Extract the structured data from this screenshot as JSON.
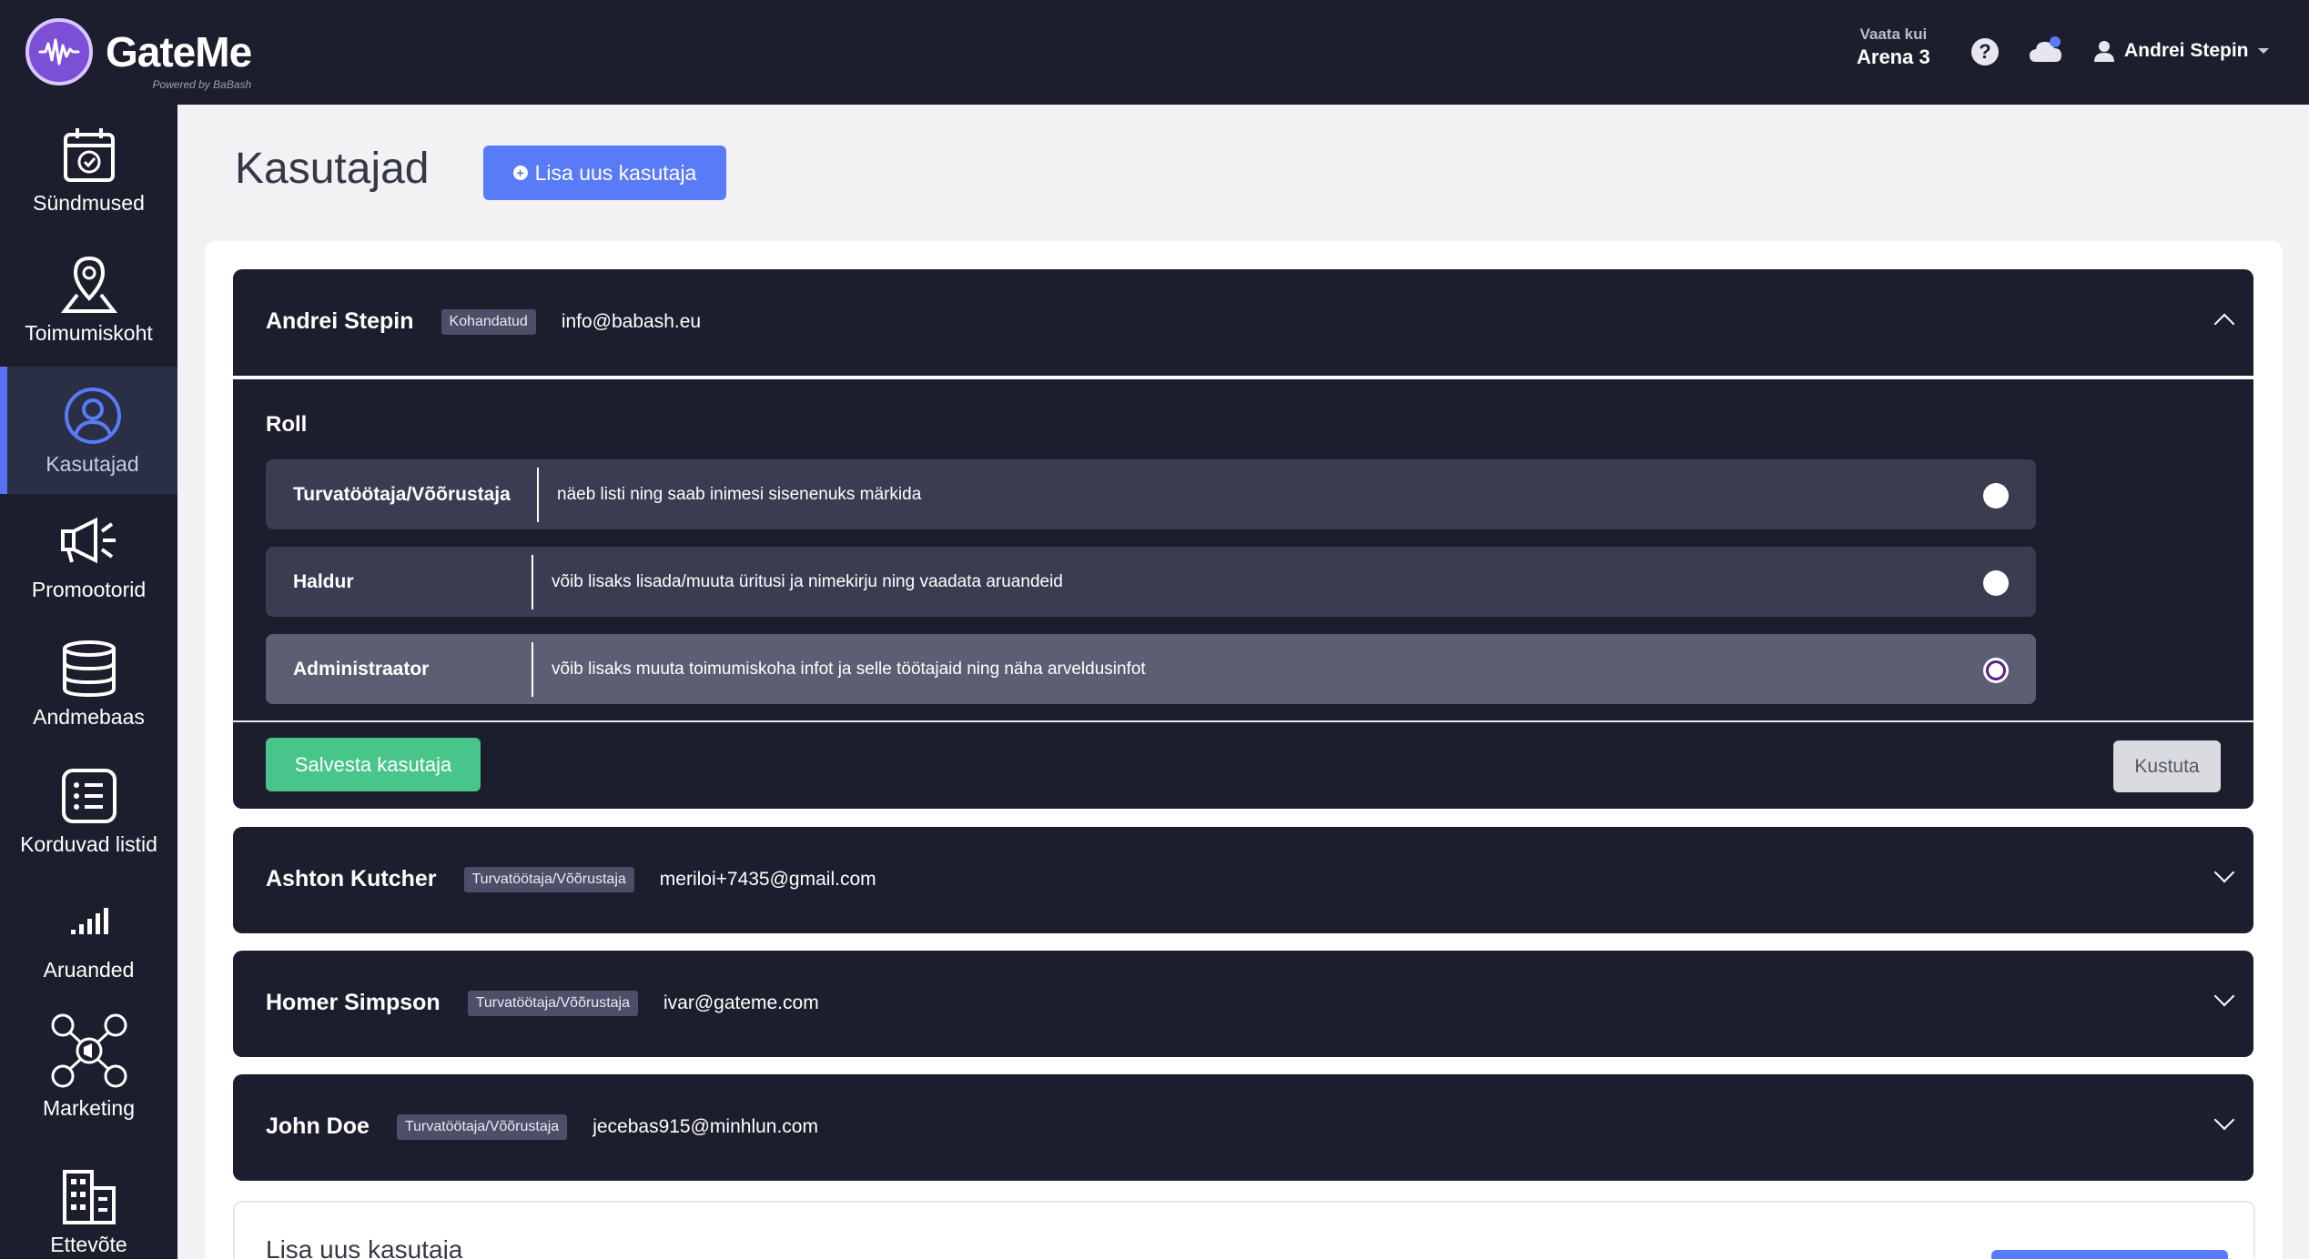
{
  "brand": {
    "name": "GateMe",
    "subtitle": "Powered by BaBash",
    "accent": "#7b4fd6"
  },
  "header": {
    "view_as_label": "Vaata kui",
    "view_as_value": "Arena 3",
    "help_icon": "question-circle-icon",
    "notifications_icon": "cloud-icon",
    "user_name": "Andrei Stepin"
  },
  "sidebar": {
    "items": [
      {
        "label": "Sündmused",
        "icon": "calendar-icon"
      },
      {
        "label": "Toimumiskoht",
        "icon": "location-pin-icon"
      },
      {
        "label": "Kasutajad",
        "icon": "user-icon",
        "active": true
      },
      {
        "label": "Promootorid",
        "icon": "megaphone-icon"
      },
      {
        "label": "Andmebaas",
        "icon": "database-icon"
      },
      {
        "label": "Korduvad listid",
        "icon": "list-icon"
      },
      {
        "label": "Aruanded",
        "icon": "signal-bars-icon"
      },
      {
        "label": "Marketing",
        "icon": "social-network-icon"
      },
      {
        "label": "Ettevõte",
        "icon": "building-icon"
      }
    ]
  },
  "main": {
    "title": "Kasutajad",
    "add_user_label": "Lisa uus kasutaja",
    "users": [
      {
        "name": "Andrei Stepin",
        "badge": "Kohandatud",
        "email": "info@babash.eu",
        "expanded": true
      },
      {
        "name": "Ashton Kutcher",
        "badge": "Turvatöötaja/Võõrustaja",
        "email": "meriloi+7435@gmail.com"
      },
      {
        "name": "Homer Simpson",
        "badge": "Turvatöötaja/Võõrustaja",
        "email": "ivar@gateme.com"
      },
      {
        "name": "John Doe",
        "badge": "Turvatöötaja/Võõrustaja",
        "email": "jecebas915@minhlun.com"
      }
    ],
    "role_section": {
      "label": "Roll",
      "roles": [
        {
          "name": "Turvatöötaja/Võõrustaja",
          "description": "näeb listi ning saab inimesi sisenenuks märkida",
          "selected": false
        },
        {
          "name": "Haldur",
          "description": "võib lisaks lisada/muuta üritusi ja nimekirju ning vaadata aruandeid",
          "selected": false
        },
        {
          "name": "Administraator",
          "description": "võib lisaks muuta toimumiskoha infot ja selle töötajaid ning näha arveldusinfot",
          "selected": true
        }
      ],
      "save_label": "Salvesta kasutaja",
      "delete_label": "Kustuta"
    },
    "new_user_section": {
      "title": "Lisa uus kasutaja"
    }
  },
  "colors": {
    "dark": "#1c1e2d",
    "primary": "#5a7bf7",
    "success": "#47c58b"
  }
}
